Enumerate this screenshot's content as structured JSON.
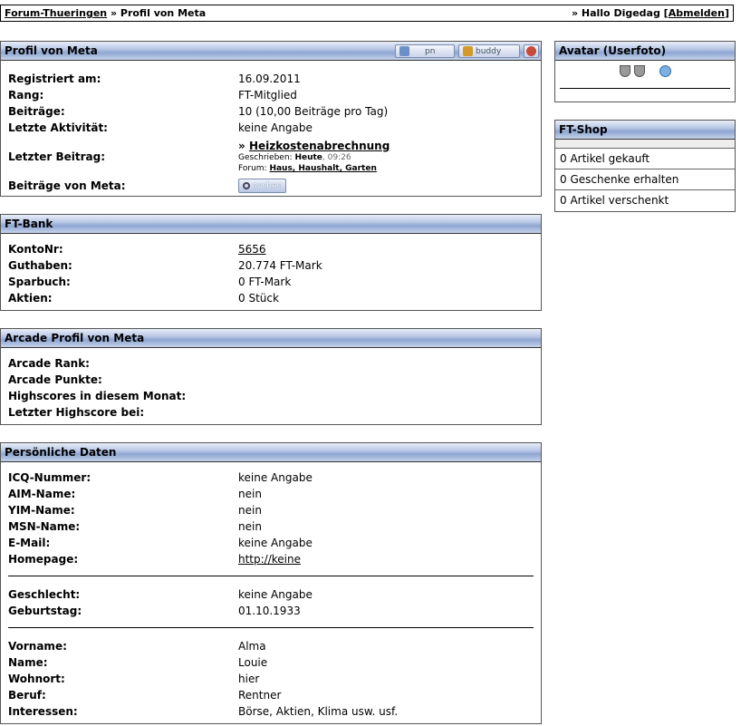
{
  "topbar": {
    "forum": "Forum-Thueringen",
    "sep": " » ",
    "page": "Profil von Meta",
    "greeting": "» Hallo Digedag [",
    "logout": "Abmelden",
    "close": "]"
  },
  "profile": {
    "title": "Profil von Meta",
    "btn_pn": "pn",
    "btn_buddy": "buddy",
    "registered_label": "Registriert am:",
    "registered": "16.09.2011",
    "rank_label": "Rang:",
    "rank": "FT-Mitglied",
    "posts_label": "Beiträge:",
    "posts": "10 (10,00 Beiträge pro Tag)",
    "activity_label": "Letzte Aktivität:",
    "activity": "keine Angabe",
    "lastpost_label": "Letzter Beitrag:",
    "lastpost_arrow": "» ",
    "lastpost_title": "Heizkostenabrechnung",
    "written_label": "Geschrieben: ",
    "written_day": "Heute",
    "written_time": ", 09:26",
    "forum_label": "Forum: ",
    "forum_name": "Haus, Haushalt, Garten",
    "posts_by_label": "Beiträge von Meta:",
    "search_btn": "suchen"
  },
  "bank": {
    "title": "FT-Bank",
    "konto_label": "KontoNr:",
    "konto": "5656",
    "guthaben_label": "Guthaben:",
    "guthaben": "20.774 FT-Mark",
    "sparbuch_label": "Sparbuch:",
    "sparbuch": "0 FT-Mark",
    "aktien_label": "Aktien:",
    "aktien": "0 Stück"
  },
  "arcade": {
    "title": "Arcade Profil von Meta",
    "rank_label": "Arcade Rank:",
    "points_label": "Arcade Punkte:",
    "highscores_label": "Highscores in diesem Monat:",
    "last_label": "Letzter Highscore bei:"
  },
  "personal": {
    "title": "Persönliche Daten",
    "icq_label": "ICQ-Nummer:",
    "icq": "keine Angabe",
    "aim_label": "AIM-Name:",
    "aim": "nein",
    "yim_label": "YIM-Name:",
    "yim": "nein",
    "msn_label": "MSN-Name:",
    "msn": "nein",
    "email_label": "E-Mail:",
    "email": "keine Angabe",
    "homepage_label": "Homepage:",
    "homepage": "http://keine",
    "gender_label": "Geschlecht:",
    "gender": "keine Angabe",
    "birthday_label": "Geburtstag:",
    "birthday": "01.10.1933",
    "firstname_label": "Vorname:",
    "firstname": "Alma",
    "name_label": "Name:",
    "name": "Louie",
    "city_label": "Wohnort:",
    "city": "hier",
    "job_label": "Beruf:",
    "job": "Rentner",
    "interests_label": "Interessen:",
    "interests": "Börse, Aktien, Klima usw. usf."
  },
  "avatar": {
    "title": "Avatar (Userfoto)"
  },
  "shop": {
    "title": "FT-Shop",
    "items": [
      "0 Artikel gekauft",
      "0 Geschenke erhalten",
      "0 Artikel verschenkt"
    ]
  }
}
